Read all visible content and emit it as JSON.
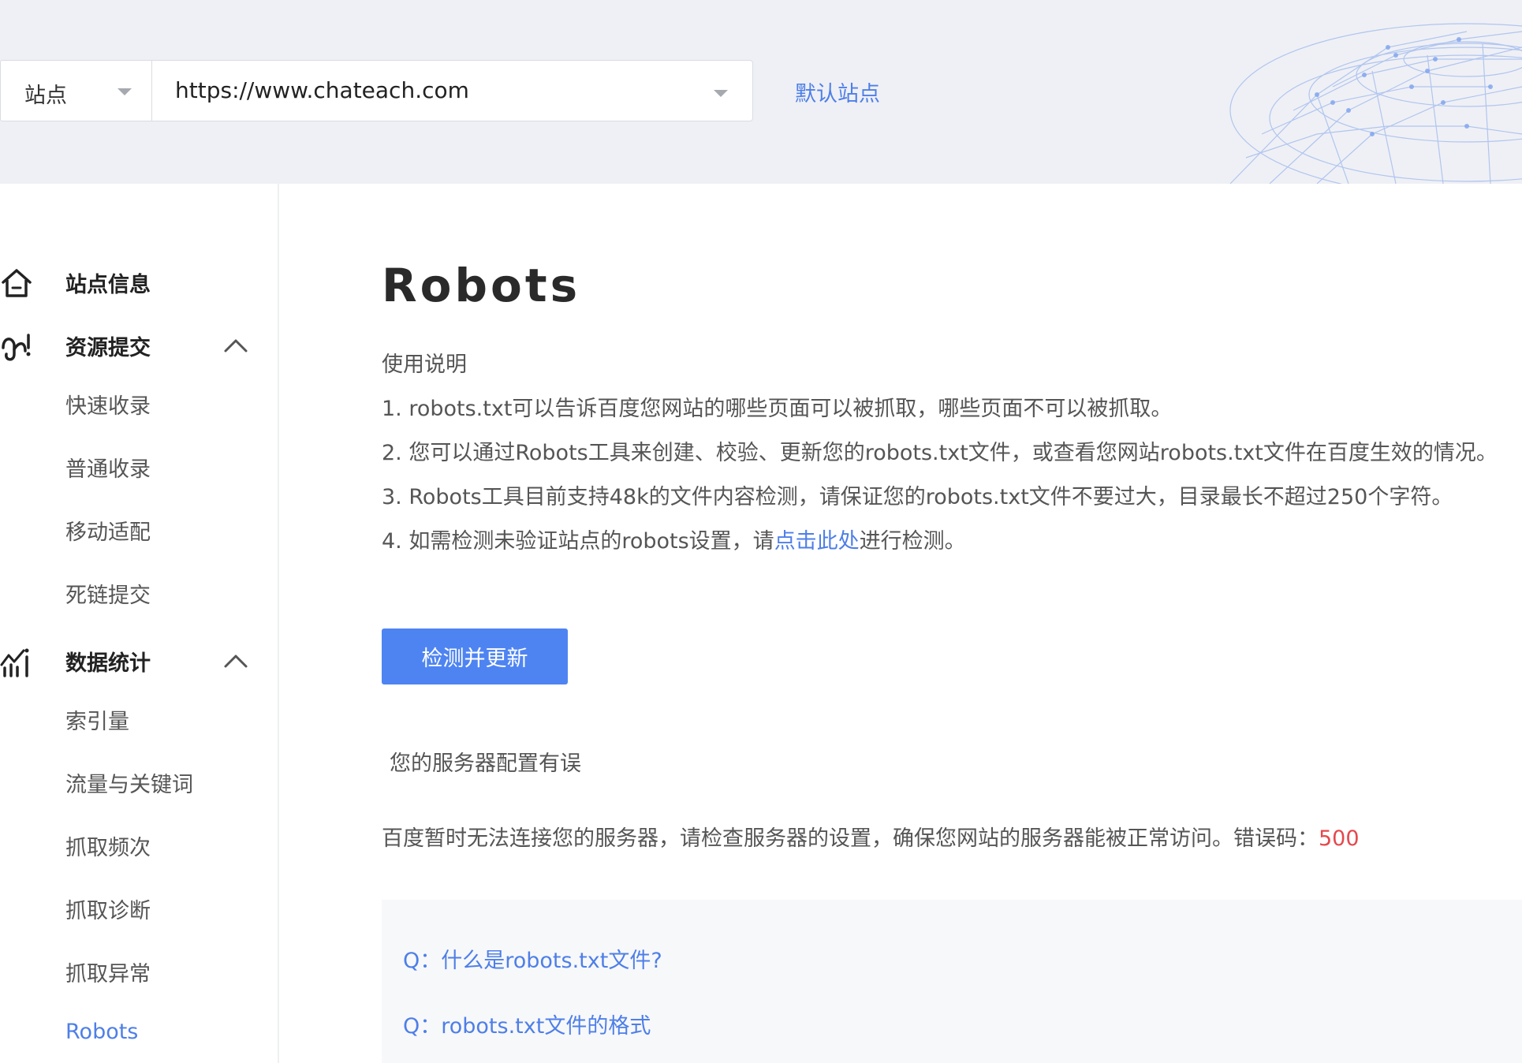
{
  "header": {
    "site_type_label": "站点",
    "site_url": "https://www.chateach.com",
    "default_site_link": "默认站点"
  },
  "sidebar": {
    "groups": [
      {
        "label": "站点信息",
        "icon": "home-icon"
      },
      {
        "label": "资源提交",
        "icon": "submit-icon",
        "expanded": true,
        "items": [
          "快速收录",
          "普通收录",
          "移动适配",
          "死链提交"
        ]
      },
      {
        "label": "数据统计",
        "icon": "chart-icon",
        "expanded": true,
        "items": [
          "索引量",
          "流量与关键词",
          "抓取频次",
          "抓取诊断",
          "抓取异常",
          "Robots"
        ]
      }
    ],
    "active_item": "Robots"
  },
  "main": {
    "title": "Robots",
    "instructions_heading": "使用说明",
    "instructions": [
      "1. robots.txt可以告诉百度您网站的哪些页面可以被抓取，哪些页面不可以被抓取。",
      "2. 您可以通过Robots工具来创建、校验、更新您的robots.txt文件，或查看您网站robots.txt文件在百度生效的情况。",
      "3. Robots工具目前支持48k的文件内容检测，请保证您的robots.txt文件不要过大，目录最长不超过250个字符。"
    ],
    "instruction4": {
      "prefix": "4. 如需检测未验证站点的robots设置，请",
      "link": "点击此处",
      "suffix": "进行检测。"
    },
    "check_button": "检测并更新",
    "result_title": "您的服务器配置有误",
    "result_desc": "百度暂时无法连接您的服务器，请检查服务器的设置，确保您网站的服务器能被正常访问。错误码：",
    "error_code": "500",
    "faq": [
      "Q：什么是robots.txt文件?",
      "Q：robots.txt文件的格式"
    ]
  },
  "colors": {
    "accent": "#4e7fe8",
    "button": "#4e84f2",
    "error": "#e5484d",
    "header_bg": "#eff0f5"
  }
}
